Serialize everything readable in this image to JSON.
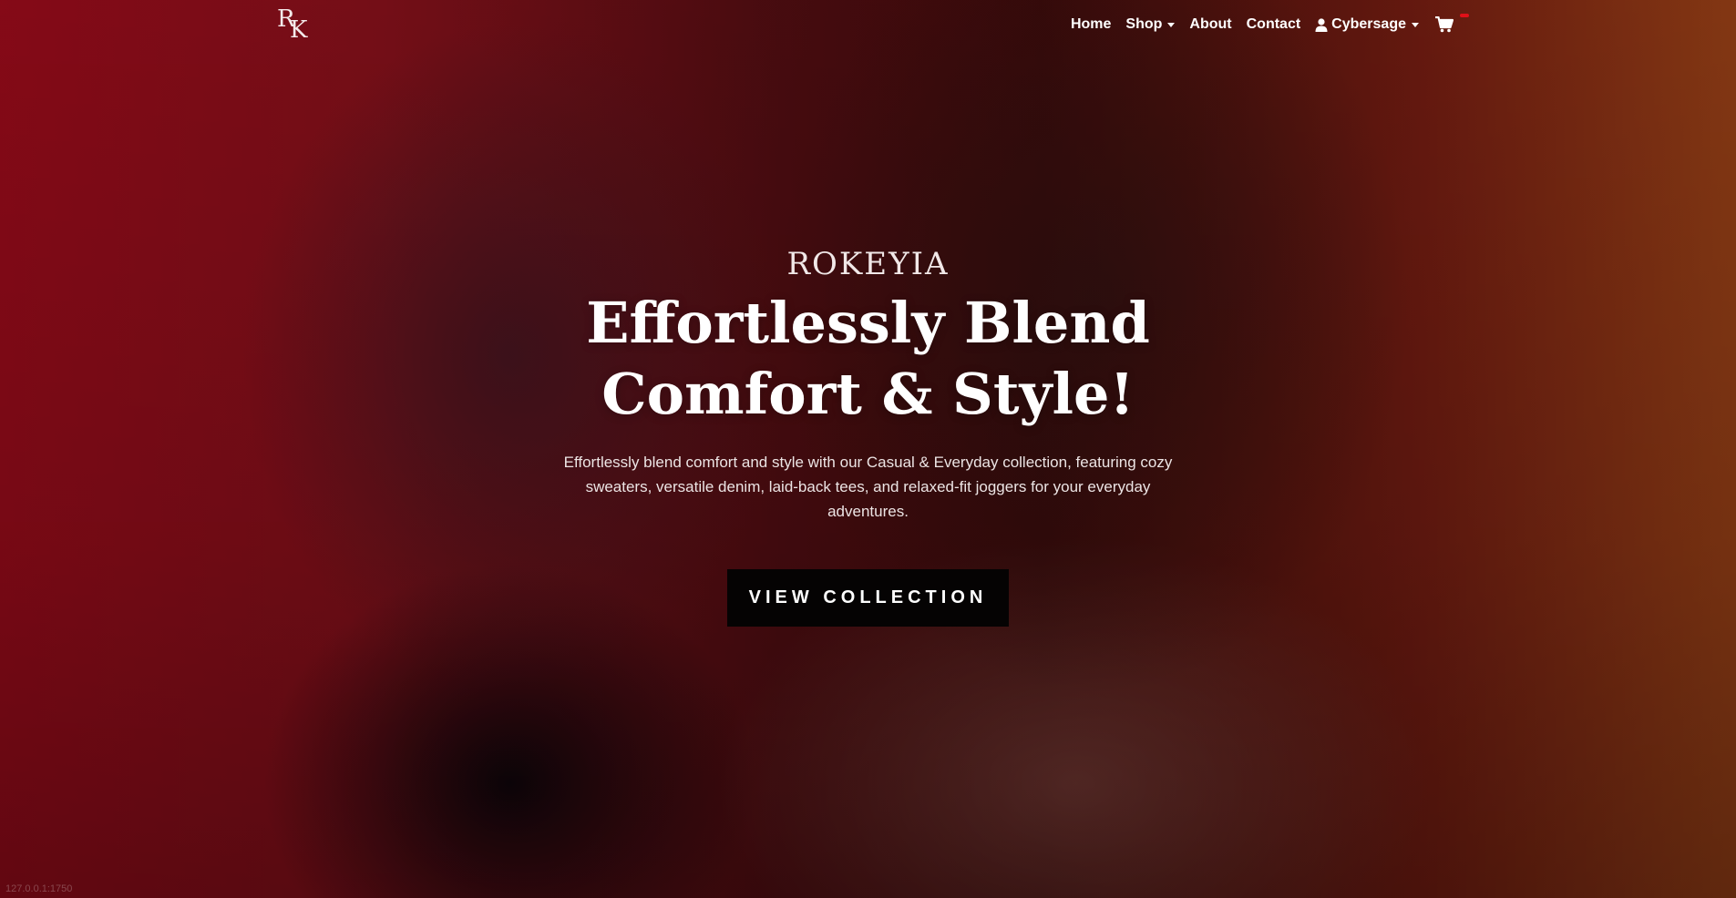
{
  "nav": {
    "logo": {
      "letter_top": "R",
      "letter_bottom": "K"
    },
    "home": "Home",
    "shop": "Shop",
    "about": "About",
    "contact": "Contact",
    "user": "Cybersage",
    "icons": {
      "user": "user-icon",
      "cart": "cart-icon"
    }
  },
  "hero": {
    "brand": "ROKEYIA",
    "headline_line1": "Effortlessly Blend",
    "headline_line2": "Comfort & Style!",
    "description": "Effortlessly blend comfort and style with our Casual & Everyday collection, featuring cozy sweaters, versatile denim, laid-back tees, and relaxed-fit joggers for your everyday adventures.",
    "cta": "VIEW COLLECTION"
  },
  "status": {
    "url": "127.0.0.1:1750"
  },
  "colors": {
    "accent": "#e01018",
    "button_bg": "#050303",
    "text": "#ffffff"
  }
}
